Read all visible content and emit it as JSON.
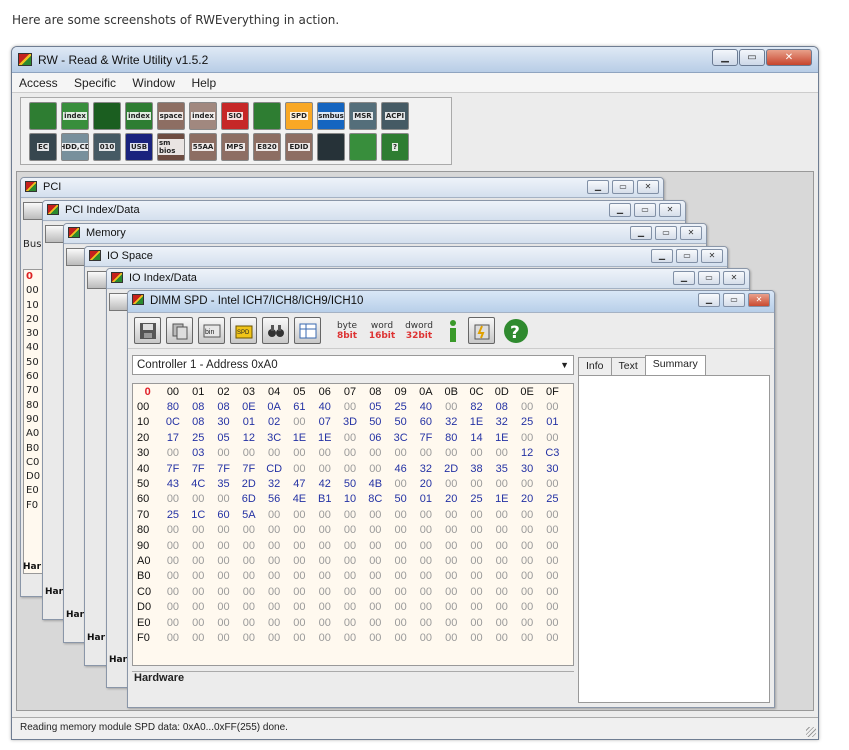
{
  "caption": "Here are some screenshots of RWEverything in action.",
  "app": {
    "title": "RW - Read & Write Utility v1.5.2",
    "menu": [
      "Access",
      "Specific",
      "Window",
      "Help"
    ],
    "status": "Reading memory module SPD data: 0xA0...0xFF(255) done."
  },
  "toolbar": {
    "row1": [
      {
        "name": "pci-icon",
        "label": "",
        "color": "#2e7d32"
      },
      {
        "name": "pci-index-icon",
        "label": "index",
        "color": "#388e3c"
      },
      {
        "name": "memory-icon",
        "label": "",
        "color": "#1b5e20"
      },
      {
        "name": "memory-index-icon",
        "label": "index",
        "color": "#2e7d32"
      },
      {
        "name": "io-space-icon",
        "label": "space",
        "color": "#8d6e63"
      },
      {
        "name": "io-index-icon",
        "label": "index",
        "color": "#a1887f"
      },
      {
        "name": "sio-icon",
        "label": "SIO",
        "color": "#c62828"
      },
      {
        "name": "waveform-icon",
        "label": "",
        "color": "#2e7d32"
      },
      {
        "name": "spd-icon",
        "label": "SPD",
        "color": "#f9a825"
      },
      {
        "name": "smbus-icon",
        "label": "smbus",
        "color": "#1565c0"
      },
      {
        "name": "msr-icon",
        "label": "MSR",
        "color": "#546e7a"
      },
      {
        "name": "acpi-icon",
        "label": "ACPI",
        "color": "#455a64"
      }
    ],
    "row2": [
      {
        "name": "ec-icon",
        "label": "EC",
        "color": "#37474f"
      },
      {
        "name": "hdd-cd-icon",
        "label": "HDD,CD",
        "color": "#78909c"
      },
      {
        "name": "pcmcia-icon",
        "label": "010",
        "color": "#455a64"
      },
      {
        "name": "usb-icon",
        "label": "USB",
        "color": "#1a237e"
      },
      {
        "name": "smbios-icon",
        "label": "sm bios",
        "color": "#6d4c41"
      },
      {
        "name": "55aa-icon",
        "label": "55AA",
        "color": "#8d6e63"
      },
      {
        "name": "mps-icon",
        "label": "MPS",
        "color": "#8d6e63"
      },
      {
        "name": "e820-icon",
        "label": "E820",
        "color": "#8d6e63"
      },
      {
        "name": "edid-icon",
        "label": "EDID",
        "color": "#8d6e63"
      },
      {
        "name": "command-icon",
        "label": "",
        "color": "#263238"
      },
      {
        "name": "battery-icon",
        "label": "",
        "color": "#388e3c"
      },
      {
        "name": "help-icon",
        "label": "?",
        "color": "#2e7d32"
      }
    ]
  },
  "windows": {
    "pci": {
      "title": "PCI",
      "side_label": "Bus",
      "hw": "Har"
    },
    "pci_index": {
      "title": "PCI Index/Data",
      "hw": "Har"
    },
    "memory": {
      "title": "Memory",
      "hw": "Har"
    },
    "io_space": {
      "title": "IO Space",
      "hw": "Har"
    },
    "io_index": {
      "title": "IO Index/Data",
      "hw": "Har"
    },
    "row_labels": [
      "0",
      "00",
      "10",
      "20",
      "30",
      "40",
      "50",
      "60",
      "70",
      "80",
      "90",
      "A0",
      "B0",
      "C0",
      "D0",
      "E0",
      "F0"
    ]
  },
  "dimm": {
    "title": "DIMM SPD - Intel ICH7/ICH8/ICH9/ICH10",
    "toolbar_labels": {
      "byte_top": "byte",
      "byte_bot": "8bit",
      "word_top": "word",
      "word_bot": "16bit",
      "dword_top": "dword",
      "dword_bot": "32bit"
    },
    "controller": "Controller 1 - Address 0xA0",
    "corner": "0",
    "columns": [
      "00",
      "01",
      "02",
      "03",
      "04",
      "05",
      "06",
      "07",
      "08",
      "09",
      "0A",
      "0B",
      "0C",
      "0D",
      "0E",
      "0F"
    ],
    "rows": [
      {
        "addr": "00",
        "vals": [
          "80",
          "08",
          "08",
          "0E",
          "0A",
          "61",
          "40",
          "00",
          "05",
          "25",
          "40",
          "00",
          "82",
          "08",
          "00",
          "00"
        ]
      },
      {
        "addr": "10",
        "vals": [
          "0C",
          "08",
          "30",
          "01",
          "02",
          "00",
          "07",
          "3D",
          "50",
          "50",
          "60",
          "32",
          "1E",
          "32",
          "25",
          "01"
        ]
      },
      {
        "addr": "20",
        "vals": [
          "17",
          "25",
          "05",
          "12",
          "3C",
          "1E",
          "1E",
          "00",
          "06",
          "3C",
          "7F",
          "80",
          "14",
          "1E",
          "00",
          "00"
        ]
      },
      {
        "addr": "30",
        "vals": [
          "00",
          "03",
          "00",
          "00",
          "00",
          "00",
          "00",
          "00",
          "00",
          "00",
          "00",
          "00",
          "00",
          "00",
          "12",
          "C3"
        ]
      },
      {
        "addr": "40",
        "vals": [
          "7F",
          "7F",
          "7F",
          "7F",
          "CD",
          "00",
          "00",
          "00",
          "00",
          "46",
          "32",
          "2D",
          "38",
          "35",
          "30",
          "30"
        ]
      },
      {
        "addr": "50",
        "vals": [
          "43",
          "4C",
          "35",
          "2D",
          "32",
          "47",
          "42",
          "50",
          "4B",
          "00",
          "20",
          "00",
          "00",
          "00",
          "00",
          "00"
        ]
      },
      {
        "addr": "60",
        "vals": [
          "00",
          "00",
          "00",
          "6D",
          "56",
          "4E",
          "B1",
          "10",
          "8C",
          "50",
          "01",
          "20",
          "25",
          "1E",
          "20",
          "25"
        ]
      },
      {
        "addr": "70",
        "vals": [
          "25",
          "1C",
          "60",
          "5A",
          "00",
          "00",
          "00",
          "00",
          "00",
          "00",
          "00",
          "00",
          "00",
          "00",
          "00",
          "00"
        ]
      },
      {
        "addr": "80",
        "vals": [
          "00",
          "00",
          "00",
          "00",
          "00",
          "00",
          "00",
          "00",
          "00",
          "00",
          "00",
          "00",
          "00",
          "00",
          "00",
          "00"
        ]
      },
      {
        "addr": "90",
        "vals": [
          "00",
          "00",
          "00",
          "00",
          "00",
          "00",
          "00",
          "00",
          "00",
          "00",
          "00",
          "00",
          "00",
          "00",
          "00",
          "00"
        ]
      },
      {
        "addr": "A0",
        "vals": [
          "00",
          "00",
          "00",
          "00",
          "00",
          "00",
          "00",
          "00",
          "00",
          "00",
          "00",
          "00",
          "00",
          "00",
          "00",
          "00"
        ]
      },
      {
        "addr": "B0",
        "vals": [
          "00",
          "00",
          "00",
          "00",
          "00",
          "00",
          "00",
          "00",
          "00",
          "00",
          "00",
          "00",
          "00",
          "00",
          "00",
          "00"
        ]
      },
      {
        "addr": "C0",
        "vals": [
          "00",
          "00",
          "00",
          "00",
          "00",
          "00",
          "00",
          "00",
          "00",
          "00",
          "00",
          "00",
          "00",
          "00",
          "00",
          "00"
        ]
      },
      {
        "addr": "D0",
        "vals": [
          "00",
          "00",
          "00",
          "00",
          "00",
          "00",
          "00",
          "00",
          "00",
          "00",
          "00",
          "00",
          "00",
          "00",
          "00",
          "00"
        ]
      },
      {
        "addr": "E0",
        "vals": [
          "00",
          "00",
          "00",
          "00",
          "00",
          "00",
          "00",
          "00",
          "00",
          "00",
          "00",
          "00",
          "00",
          "00",
          "00",
          "00"
        ]
      },
      {
        "addr": "F0",
        "vals": [
          "00",
          "00",
          "00",
          "00",
          "00",
          "00",
          "00",
          "00",
          "00",
          "00",
          "00",
          "00",
          "00",
          "00",
          "00",
          "00"
        ]
      }
    ],
    "hardware_label": "Hardware",
    "tabs": [
      "Info",
      "Text",
      "Summary"
    ],
    "active_tab": "Summary"
  }
}
